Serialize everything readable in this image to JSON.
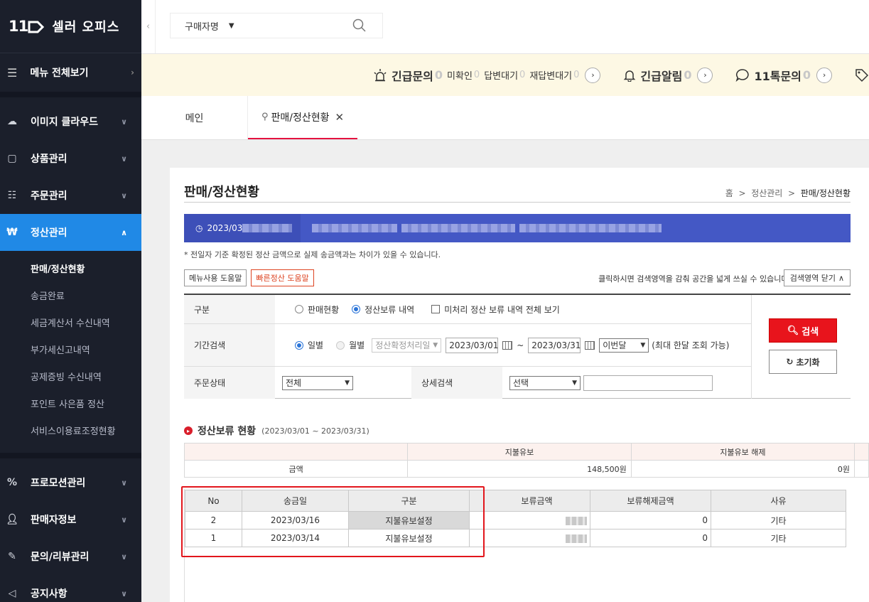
{
  "app": {
    "logo": "11",
    "logo_text": "셀러 오피스",
    "menu_all": "메뉴 전체보기"
  },
  "sidebar": {
    "items": [
      {
        "label": "이미지 클라우드",
        "icon": "cloud-icon"
      },
      {
        "label": "상품관리",
        "icon": "product-icon"
      },
      {
        "label": "주문관리",
        "icon": "order-icon"
      },
      {
        "label": "정산관리",
        "icon": "won-icon",
        "active": true
      },
      {
        "label": "프로모션관리",
        "icon": "percent-icon"
      },
      {
        "label": "판매자정보",
        "icon": "person-icon"
      },
      {
        "label": "문의/리뷰관리",
        "icon": "pencil-icon"
      },
      {
        "label": "공지사항",
        "icon": "megaphone-icon"
      }
    ],
    "sub_items": [
      "판매/정산현황",
      "송금완료",
      "세금계산서 수신내역",
      "부가세신고내역",
      "공제증빙 수신내역",
      "포인트 사은품 정산",
      "서비스이용료조정현황"
    ]
  },
  "topbar": {
    "search_scope": "구매자명"
  },
  "alerts": {
    "urgent_inquiry": {
      "label": "긴급문의",
      "count": "0"
    },
    "unconfirmed": {
      "label": "미확인",
      "count": "0"
    },
    "awaiting_reply": {
      "label": "답변대기",
      "count": "0"
    },
    "awaiting_rereply": {
      "label": "재답변대기",
      "count": "0"
    },
    "urgent_alert": {
      "label": "긴급알림",
      "count": "0"
    },
    "talk": {
      "label": "11톡문의",
      "count": "0"
    }
  },
  "tabs": {
    "main": "메인",
    "current": "판매/정산현황"
  },
  "page": {
    "title": "판매/정산현황",
    "breadcrumb": [
      "홈",
      "정산관리",
      "판매/정산현황"
    ],
    "notice_date": "2023/03",
    "note": "* 전일자 기준 확정된 정산 금액으로 실제 송금액과는 차이가 있을 수 있습니다.",
    "help_menu": "메뉴사용 도움말",
    "help_quick": "빠른정산 도움말",
    "hint": "클릭하시면 검색영역을 감춰 공간을 넓게 쓰실 수 있습니다.",
    "fold_button": "검색영역 닫기"
  },
  "search": {
    "type_label": "구분",
    "type_options": [
      "판매현황",
      "정산보류 내역"
    ],
    "type_selected": "정산보류 내역",
    "unprocessed_check": "미처리 정산 보류 내역 전체 보기",
    "period_label": "기간검색",
    "period_daily": "일별",
    "period_monthly": "월별",
    "period_basis": "정산확정처리일",
    "date_from": "2023/03/01",
    "tilde": "~",
    "date_to": "2023/03/31",
    "preset": "이번달",
    "period_note": "(최대 한달 조회 가능)",
    "order_status_label": "주문상태",
    "order_status_value": "전체",
    "detail_label": "상세검색",
    "detail_value": "선택",
    "detail_input": "",
    "search_button": "검색",
    "reset_button": "초기화"
  },
  "section": {
    "title": "정산보류 현황",
    "range": "(2023/03/01 ~ 2023/03/31)"
  },
  "summary": {
    "headers": [
      "",
      "지불유보",
      "지불유보 해제"
    ],
    "row_label": "금액",
    "hold": "148,500원",
    "release": "0원"
  },
  "detail": {
    "headers": [
      "No",
      "송금일",
      "구분",
      "",
      "보류금액",
      "보류해제금액",
      "사유"
    ],
    "rows": [
      {
        "no": "2",
        "date": "2023/03/16",
        "type": "지불유보설정",
        "release": "0",
        "reason": "기타"
      },
      {
        "no": "1",
        "date": "2023/03/14",
        "type": "지불유보설정",
        "release": "0",
        "reason": "기타"
      }
    ]
  }
}
